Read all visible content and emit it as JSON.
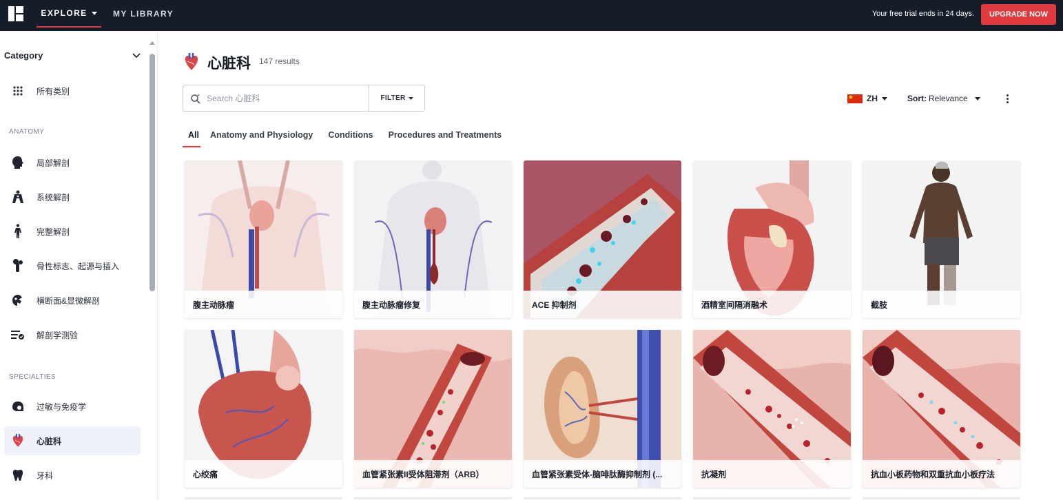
{
  "topbar": {
    "explore_label": "EXPLORE",
    "library_label": "MY LIBRARY",
    "trial_text": "Your free trial ends in 24 days.",
    "upgrade_label": "UPGRADE NOW",
    "accent_color": "#e0393e"
  },
  "sidebar": {
    "category_label": "Category",
    "all_label": "所有类别",
    "anatomy_label": "ANATOMY",
    "anatomy_items": [
      {
        "label": "局部解剖",
        "icon": "head-icon"
      },
      {
        "label": "系统解剖",
        "icon": "torso-icon"
      },
      {
        "label": "完整解剖",
        "icon": "human-figure-icon"
      },
      {
        "label": "骨性标志、起源与插入",
        "icon": "bone-icon"
      },
      {
        "label": "横断面&显微解剖",
        "icon": "cross-section-icon"
      },
      {
        "label": "解剖学测验",
        "icon": "quiz-icon"
      }
    ],
    "specialties_label": "SPECIALTIES",
    "specialty_items": [
      {
        "label": "过敏与免疫学",
        "icon": "allergy-icon"
      },
      {
        "label": "心脏科",
        "icon": "heart-icon",
        "active": true
      },
      {
        "label": "牙科",
        "icon": "tooth-icon"
      }
    ]
  },
  "main": {
    "title": "心脏科",
    "results": "147 results",
    "search_placeholder": "Search 心脏科",
    "filter_label": "FILTER",
    "language": "ZH",
    "sort_prefix": "Sort:",
    "sort_value": "Relevance",
    "tabs": [
      "All",
      "Anatomy and Physiology",
      "Conditions",
      "Procedures and Treatments"
    ],
    "cards": [
      {
        "title": "腹主动脉瘤"
      },
      {
        "title": "腹主动脉瘤修复"
      },
      {
        "title": "ACE 抑制剂"
      },
      {
        "title": "酒精室间隔消融术"
      },
      {
        "title": "截肢"
      },
      {
        "title": "心绞痛"
      },
      {
        "title": "血管紧张素II受体阻滞剂（ARB）"
      },
      {
        "title": "血管紧张素受体-脑啡肽酶抑制剂 (..."
      },
      {
        "title": "抗凝剂"
      },
      {
        "title": "抗血小板药物和双重抗血小板疗法"
      }
    ]
  }
}
